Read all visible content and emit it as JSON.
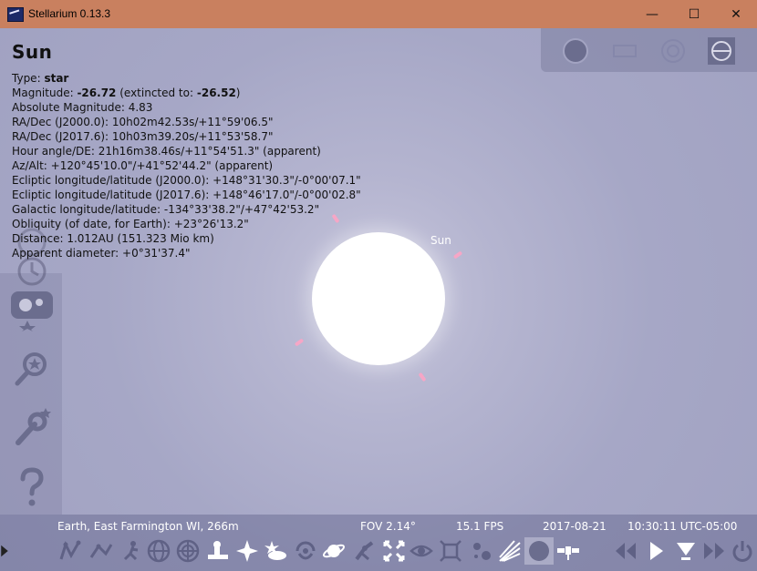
{
  "window": {
    "title": "Stellarium 0.13.3",
    "minimize": "—",
    "maximize": "☐",
    "close": "✕"
  },
  "object": {
    "name": "Sun",
    "type_label": "Type:",
    "type_value": "star",
    "magnitude_label": "Magnitude:",
    "magnitude_value": "-26.72",
    "extincted_label": "(extincted to:",
    "extincted_value": "-26.52",
    "extincted_close": ")",
    "lines": [
      "Absolute Magnitude: 4.83",
      "RA/Dec (J2000.0): 10h02m42.53s/+11°59'06.5\"",
      "RA/Dec (J2017.6): 10h03m39.20s/+11°53'58.7\"",
      "Hour angle/DE: 21h16m38.46s/+11°54'51.3\" (apparent)",
      "Az/Alt: +120°45'10.0\"/+41°52'44.2\" (apparent)",
      "Ecliptic longitude/latitude (J2000.0): +148°31'30.3\"/-0°00'07.1\"",
      "Ecliptic longitude/latitude (J2017.6): +148°46'17.0\"/-0°00'02.8\"",
      "Galactic longitude/latitude: -134°33'38.2\"/+47°42'53.2\"",
      "Obliquity (of date, for Earth): +23°26'13.2\"",
      "Distance: 1.012AU (151.323 Mio km)",
      "Apparent diameter: +0°31'37.4\""
    ],
    "sky_label": "Sun"
  },
  "status": {
    "location": "Earth, East Farmington WI, 266m",
    "fov": "FOV 2.14°",
    "fps": "15.1 FPS",
    "date": "2017-08-21",
    "time": "10:30:11 UTC-05:00"
  },
  "colors": {
    "titlebar": "#c9805f",
    "sky": "#a9aac9",
    "marker": "#f6a6c6"
  }
}
